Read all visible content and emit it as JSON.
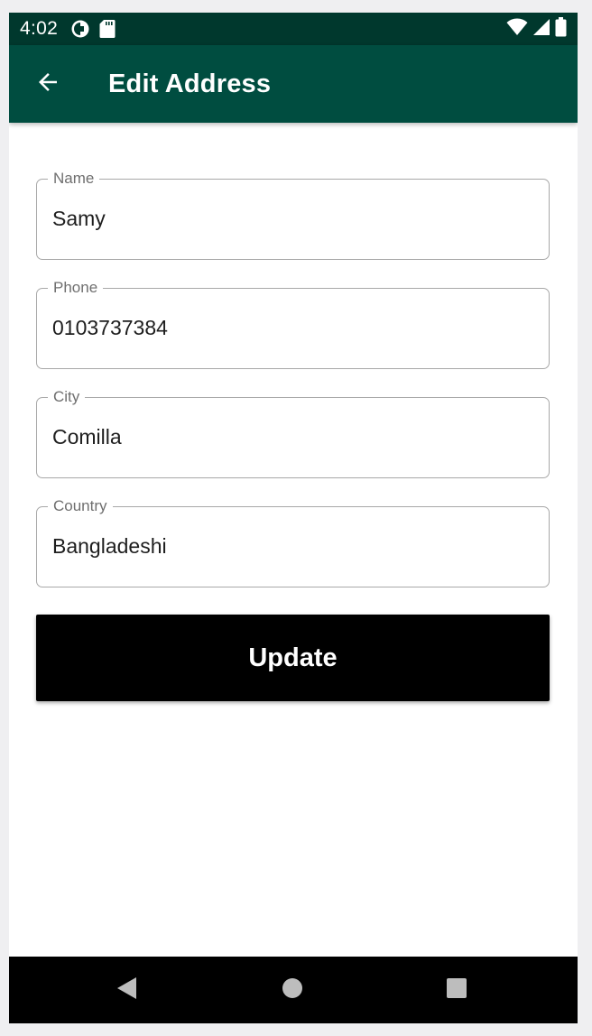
{
  "status_bar": {
    "time": "4:02",
    "icons": [
      "data-saver-icon",
      "sd-card-icon",
      "wifi-icon",
      "cell-signal-icon",
      "battery-icon"
    ]
  },
  "app_bar": {
    "title": "Edit Address",
    "back_icon": "arrow-back-icon",
    "background": "#004d40"
  },
  "form": {
    "fields": [
      {
        "label": "Name",
        "value": "Samy"
      },
      {
        "label": "Phone",
        "value": "0103737384"
      },
      {
        "label": "City",
        "value": "Comilla"
      },
      {
        "label": "Country",
        "value": "Bangladeshi"
      }
    ],
    "submit_label": "Update"
  },
  "nav_bar": {
    "icons": [
      "back-triangle-icon",
      "home-circle-icon",
      "recents-square-icon"
    ]
  }
}
